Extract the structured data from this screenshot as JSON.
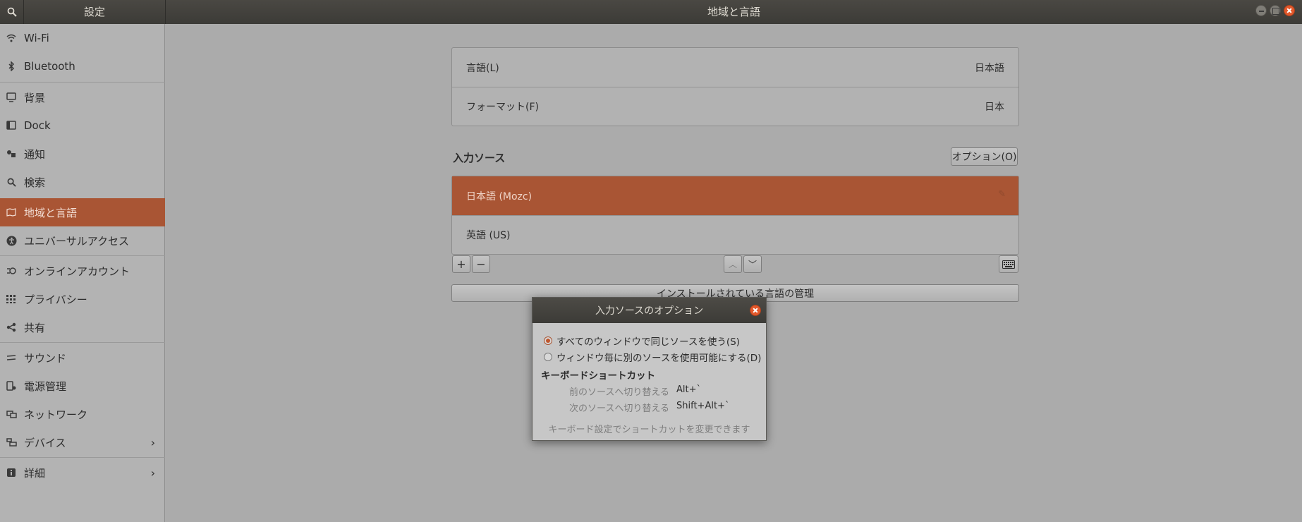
{
  "header": {
    "left_title": "設定",
    "title": "地域と言語",
    "search_icon": "search-icon",
    "window_buttons": [
      "minimize",
      "maximize",
      "close"
    ]
  },
  "sidebar": {
    "items": [
      {
        "label": "Wi-Fi",
        "icon": "wifi-icon"
      },
      {
        "label": "Bluetooth",
        "icon": "bluetooth-icon"
      },
      {
        "label": "背景",
        "icon": "background-icon"
      },
      {
        "label": "Dock",
        "icon": "dock-icon"
      },
      {
        "label": "通知",
        "icon": "notification-icon"
      },
      {
        "label": "検索",
        "icon": "search-icon"
      },
      {
        "label": "地域と言語",
        "icon": "region-icon",
        "active": true
      },
      {
        "label": "ユニバーサルアクセス",
        "icon": "accessibility-icon"
      },
      {
        "label": "オンラインアカウント",
        "icon": "online-accounts-icon"
      },
      {
        "label": "プライバシー",
        "icon": "privacy-icon"
      },
      {
        "label": "共有",
        "icon": "share-icon"
      },
      {
        "label": "サウンド",
        "icon": "sound-icon"
      },
      {
        "label": "電源管理",
        "icon": "power-icon"
      },
      {
        "label": "ネットワーク",
        "icon": "network-icon"
      },
      {
        "label": "デバイス",
        "icon": "devices-icon"
      },
      {
        "label": "詳細",
        "icon": "details-icon"
      }
    ]
  },
  "language_box": {
    "language_label": "言語(L)",
    "language_value": "日本語",
    "format_label": "フォーマット(F)",
    "format_value": "日本"
  },
  "input_sources": {
    "title": "入力ソース",
    "options_button": "オプション(O)",
    "sources": [
      "日本語 (Mozc)",
      "英語 (US)"
    ],
    "add_label": "+",
    "remove_label": "−",
    "up_label": "︿",
    "down_label": "﹀",
    "keyboard_icon": "keyboard-icon",
    "manage_button": "インストールされている言語の管理"
  },
  "dialog": {
    "title": "入力ソースのオプション",
    "radio_same": "すべてのウィンドウで同じソースを使う(S)",
    "radio_per_window": "ウィンドウ毎に別のソースを使用可能にする(D)",
    "selected": "radio_same",
    "shortcut_heading": "キーボードショートカット",
    "prev_label": "前のソースへ切り替える",
    "prev_key": "Alt+`",
    "next_label": "次のソースへ切り替える",
    "next_key": "Shift+Alt+`",
    "note": "キーボード設定でショートカットを変更できます"
  },
  "colors": {
    "accent": "#a95534",
    "header": "#3c3b37",
    "close": "#e2582b"
  }
}
